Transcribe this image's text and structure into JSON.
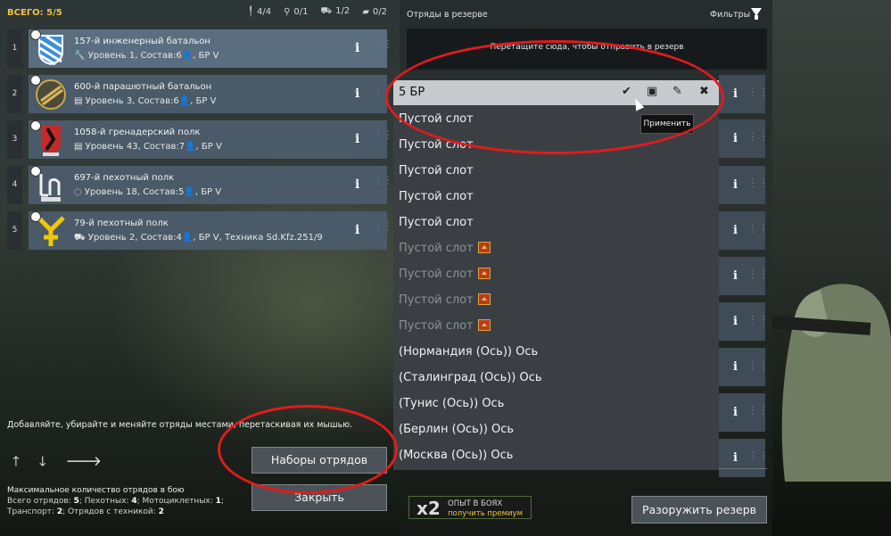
{
  "left": {
    "total_label": "ВСЕГО: 5/5",
    "counts": [
      {
        "icon": "infantry-icon",
        "glyph": "╿",
        "value": "4/4"
      },
      {
        "icon": "paratrooper-icon",
        "glyph": "⚲",
        "value": "0/1"
      },
      {
        "icon": "vehicle-icon",
        "glyph": "⛟",
        "value": "1/2"
      },
      {
        "icon": "tank-icon",
        "glyph": "▰",
        "value": "0/2"
      }
    ],
    "units": [
      {
        "num": "1",
        "name": "157-й инженерный батальон",
        "sub": "🔧 Уровень 1, Состав:6👤,  БР V"
      },
      {
        "num": "2",
        "name": "600-й парашютный батальон",
        "sub": "▤ Уровень 3, Состав:6👤,  БР V"
      },
      {
        "num": "3",
        "name": "1058-й гренадерский полк",
        "sub": "▤ Уровень 43, Состав:7👤,  БР V"
      },
      {
        "num": "4",
        "name": "697-й пехотный полк",
        "sub": "◌ Уровень 18, Состав:5👤,  БР V"
      },
      {
        "num": "5",
        "name": "79-й пехотный полк",
        "sub": "⛟ Уровень 2, Состав:4👤,  БР V,   Техника Sd.Kfz.251/9"
      }
    ],
    "hint": "Добавляйте, убирайте и меняйте отряды местами, перетаскивая их мышью.",
    "arrows": [
      "🡑",
      "🡓",
      "🡒"
    ],
    "sets_button": "Наборы отрядов",
    "close_button": "Закрыть",
    "max_title": "Максимальное количество отрядов в бою",
    "max_line1_a": "Всего отрядов: ",
    "max_line1_b": "5",
    "max_line1_c": "; Пехотных: ",
    "max_line1_d": "4",
    "max_line1_e": "; Мотоциклетных: ",
    "max_line1_f": "1",
    "max_line1_g": ";",
    "max_line2_a": "Транспорт: ",
    "max_line2_b": "2",
    "max_line2_c": "; Отрядов с техникой: ",
    "max_line2_d": "2"
  },
  "right": {
    "title": "Отряды в резерве",
    "filter": "Фильтры",
    "drop_hint": "Перетащите сюда, чтобы отправить в резерв",
    "xp_mult": "x2",
    "xp_line1": "ОПЫТ В БОЯХ",
    "xp_line2": "получить премиум",
    "disarm_button": "Разоружить резерв",
    "info_glyph": "i",
    "grip_glyph": "⋮⋮"
  },
  "dropdown": {
    "selected": "5 БР",
    "apply_tooltip": "Применить",
    "items": [
      {
        "label": "Пустой слот",
        "locked": false
      },
      {
        "label": "Пустой слот",
        "locked": false
      },
      {
        "label": "Пустой слот",
        "locked": false
      },
      {
        "label": "Пустой слот",
        "locked": false
      },
      {
        "label": "Пустой слот",
        "locked": false
      },
      {
        "label": "Пустой слот",
        "locked": true
      },
      {
        "label": "Пустой слот",
        "locked": true
      },
      {
        "label": "Пустой слот",
        "locked": true
      },
      {
        "label": "Пустой слот",
        "locked": true
      },
      {
        "label": "(Нормандия (Ось)) Ось",
        "locked": false
      },
      {
        "label": "(Сталинград (Ось)) Ось",
        "locked": false
      },
      {
        "label": "(Тунис (Ось)) Ось",
        "locked": false
      },
      {
        "label": "(Берлин (Ось)) Ось",
        "locked": false
      },
      {
        "label": "(Москва (Ось)) Ось",
        "locked": false
      }
    ]
  },
  "colors": {
    "accent": "#f0c23a",
    "annotation": "#e11b1b"
  }
}
